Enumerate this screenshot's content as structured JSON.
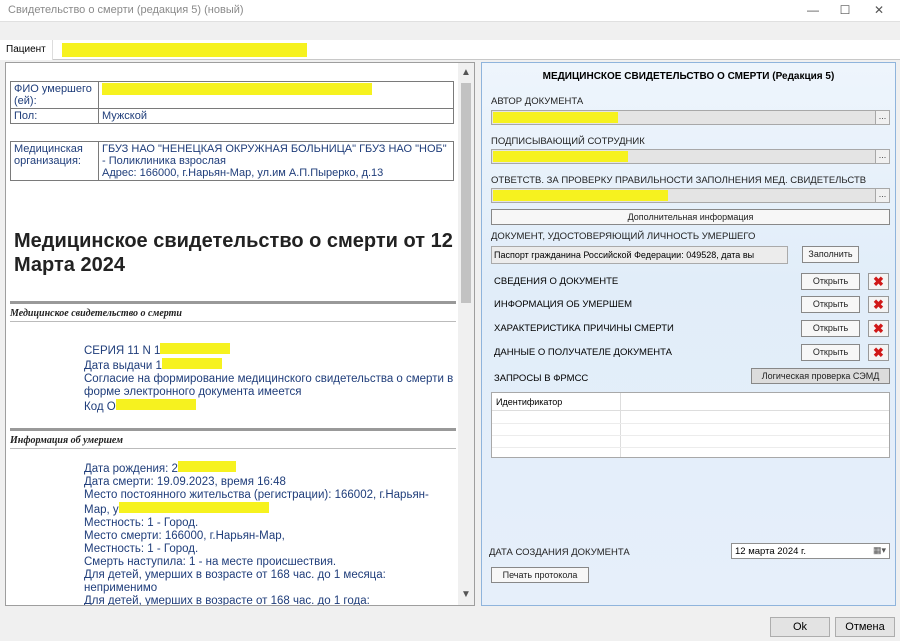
{
  "window": {
    "title": "Свидетельство о смерти (редакция 5) (новый)"
  },
  "patient_tab": {
    "label": "Пациент"
  },
  "document": {
    "fio_label": "ФИО умершего (ей):",
    "sex_label": "Пол:",
    "sex_value": "Мужской",
    "org_label": "Медицинская организация:",
    "org_value": "ГБУЗ НАО \"НЕНЕЦКАЯ ОКРУЖНАЯ БОЛЬНИЦА\" ГБУЗ НАО \"НОБ\" - Поликлиника взрослая",
    "org_address": "Адрес: 166000, г.Нарьян-Мар, ул.им А.П.Пырерко, д.13",
    "heading": "Медицинское свидетельство о смерти от 12 Марта 2024",
    "section1_title": "Медицинское свидетельство о смерти",
    "section1_lines": [
      "СЕРИЯ 11 N 1",
      "Дата выдачи 1",
      "Согласие на формирование медицинского свидетельства о смерти в форме электронного документа имеется",
      "Код О"
    ],
    "section2_title": "Информация об умершем",
    "section2_lines": [
      "Дата рождения: 2",
      "Дата смерти: 19.09.2023, время 16:48",
      "Место постоянного жительства (регистрации): 166002, г.Нарьян-Мар, у",
      "Местность: 1 - Город.",
      "Место смерти: 166000, г.Нарьян-Мар,",
      "Местность: 1 - Город.",
      "Смерть наступила: 1 - на месте происшествия.",
      "Для детей, умерших в возрасте от 168 час. до 1 месяца: неприменимо",
      "Для детей, умерших в возрасте от 168 час. до 1 года:"
    ]
  },
  "form": {
    "title": "МЕДИЦИНСКОЕ СВИДЕТЕЛЬСТВО О СМЕРТИ (Редакция 5)",
    "author_label": "АВТОР ДОКУМЕНТА",
    "signer_label": "ПОДПИСЫВАЮЩИЙ СОТРУДНИК",
    "checker_label": "ОТВЕТСТВ. ЗА ПРОВЕРКУ ПРАВИЛЬНОСТИ ЗАПОЛНЕНИЯ МЕД. СВИДЕТЕЛЬСТВ",
    "extra_info_button": "Дополнительная информация",
    "identity_label": "ДОКУМЕНТ, УДОСТОВЕРЯЮЩИЙ ЛИЧНОСТЬ УМЕРШЕГО",
    "identity_value": "Паспорт гражданина Российской Федерации: 049528, дата вы",
    "fill_button": "Заполнить",
    "rows": [
      {
        "label": "СВЕДЕНИЯ О ДОКУМЕНТЕ",
        "button": "Открыть"
      },
      {
        "label": "ИНФОРМАЦИЯ ОБ УМЕРШЕМ",
        "button": "Открыть"
      },
      {
        "label": "ХАРАКТЕРИСТИКА ПРИЧИНЫ СМЕРТИ",
        "button": "Открыть"
      },
      {
        "label": "ДАННЫЕ О ПОЛУЧАТЕЛЕ ДОКУМЕНТА",
        "button": "Открыть"
      }
    ],
    "requests_label": "ЗАПРОСЫ В ФРМСС",
    "check_button": "Логическая проверка СЭМД",
    "grid_header": "Идентификатор",
    "date_label": "ДАТА СОЗДАНИЯ ДОКУМЕНТА",
    "date_value": "12   марта   2024 г.",
    "print_button": "Печать протокола"
  },
  "footer": {
    "ok": "Ok",
    "cancel": "Отмена"
  }
}
